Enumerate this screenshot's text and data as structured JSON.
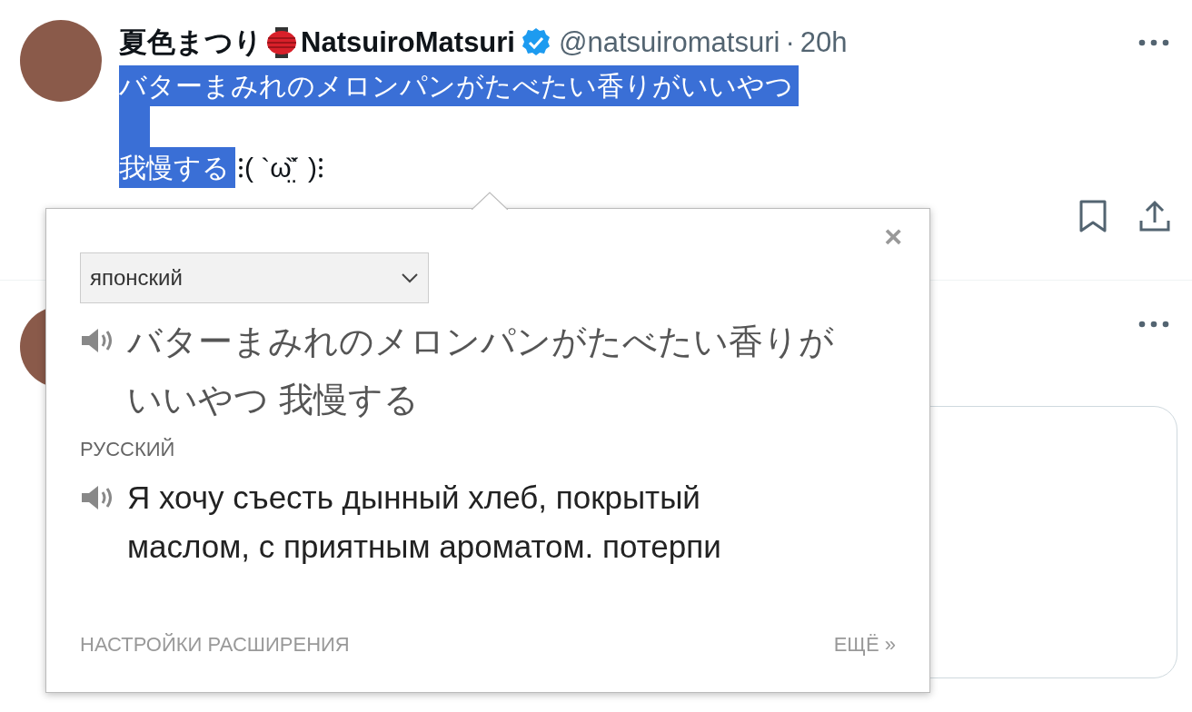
{
  "tweet": {
    "display_name": "夏色まつり",
    "username": "NatsuiroMatsuri",
    "verified": true,
    "handle": "@natsuiromatsuri",
    "separator": "·",
    "time": "20h",
    "text_lines": [
      {
        "segments": [
          {
            "text": "バターまみれのメロンパンがたべたい香りがいいやつ",
            "selected": true
          }
        ]
      },
      {
        "segments": [
          {
            "text": "我慢する",
            "selected": true
          },
          {
            "text": "⁝( `ω̤̏´ )⁝",
            "selected": false
          }
        ]
      }
    ]
  },
  "translator": {
    "close": "×",
    "source_language": "японский",
    "source_text": "バターまみれのメロンパンがたべたい香りがいいやつ 我慢する",
    "target_language": "РУССКИЙ",
    "translation": "Я хочу съесть дынный хлеб, покрытый маслом, с приятным ароматом. потерпи",
    "settings_link": "НАСТРОЙКИ РАСШИРЕНИЯ",
    "more_link": "ЕЩЁ »"
  }
}
